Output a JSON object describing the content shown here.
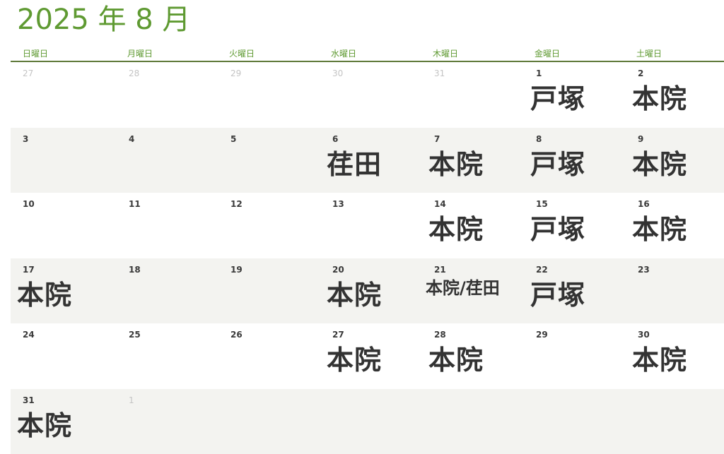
{
  "calendar": {
    "title": "2025 年 8 月",
    "weekdays": [
      "日曜日",
      "月曜日",
      "火曜日",
      "水曜日",
      "木曜日",
      "金曜日",
      "土曜日"
    ],
    "weeks": [
      [
        {
          "day": "27",
          "muted": true,
          "place": ""
        },
        {
          "day": "28",
          "muted": true,
          "place": ""
        },
        {
          "day": "29",
          "muted": true,
          "place": ""
        },
        {
          "day": "30",
          "muted": true,
          "place": ""
        },
        {
          "day": "31",
          "muted": true,
          "place": ""
        },
        {
          "day": "1",
          "muted": false,
          "place": "戸塚"
        },
        {
          "day": "2",
          "muted": false,
          "place": "本院"
        }
      ],
      [
        {
          "day": "3",
          "muted": false,
          "place": ""
        },
        {
          "day": "4",
          "muted": false,
          "place": ""
        },
        {
          "day": "5",
          "muted": false,
          "place": ""
        },
        {
          "day": "6",
          "muted": false,
          "place": "荏田"
        },
        {
          "day": "7",
          "muted": false,
          "place": "本院"
        },
        {
          "day": "8",
          "muted": false,
          "place": "戸塚"
        },
        {
          "day": "9",
          "muted": false,
          "place": "本院"
        }
      ],
      [
        {
          "day": "10",
          "muted": false,
          "place": ""
        },
        {
          "day": "11",
          "muted": false,
          "place": ""
        },
        {
          "day": "12",
          "muted": false,
          "place": ""
        },
        {
          "day": "13",
          "muted": false,
          "place": ""
        },
        {
          "day": "14",
          "muted": false,
          "place": "本院"
        },
        {
          "day": "15",
          "muted": false,
          "place": "戸塚"
        },
        {
          "day": "16",
          "muted": false,
          "place": "本院"
        }
      ],
      [
        {
          "day": "17",
          "muted": false,
          "place": "本院"
        },
        {
          "day": "18",
          "muted": false,
          "place": ""
        },
        {
          "day": "19",
          "muted": false,
          "place": ""
        },
        {
          "day": "20",
          "muted": false,
          "place": "本院"
        },
        {
          "day": "21",
          "muted": false,
          "place": "本院/荏田",
          "small": true
        },
        {
          "day": "22",
          "muted": false,
          "place": "戸塚"
        },
        {
          "day": "23",
          "muted": false,
          "place": ""
        }
      ],
      [
        {
          "day": "24",
          "muted": false,
          "place": ""
        },
        {
          "day": "25",
          "muted": false,
          "place": ""
        },
        {
          "day": "26",
          "muted": false,
          "place": ""
        },
        {
          "day": "27",
          "muted": false,
          "place": "本院"
        },
        {
          "day": "28",
          "muted": false,
          "place": "本院"
        },
        {
          "day": "29",
          "muted": false,
          "place": ""
        },
        {
          "day": "30",
          "muted": false,
          "place": "本院"
        }
      ],
      [
        {
          "day": "31",
          "muted": false,
          "place": "本院"
        },
        {
          "day": "1",
          "muted": true,
          "place": ""
        },
        {
          "day": "",
          "muted": true,
          "place": ""
        },
        {
          "day": "",
          "muted": true,
          "place": ""
        },
        {
          "day": "",
          "muted": true,
          "place": ""
        },
        {
          "day": "",
          "muted": true,
          "place": ""
        },
        {
          "day": "",
          "muted": true,
          "place": ""
        }
      ]
    ]
  },
  "colors": {
    "title": "#5f9a32",
    "rule": "#5f7a3a",
    "shade": "#f3f3f0",
    "muted": "#c4c4c4",
    "text": "#333333"
  }
}
